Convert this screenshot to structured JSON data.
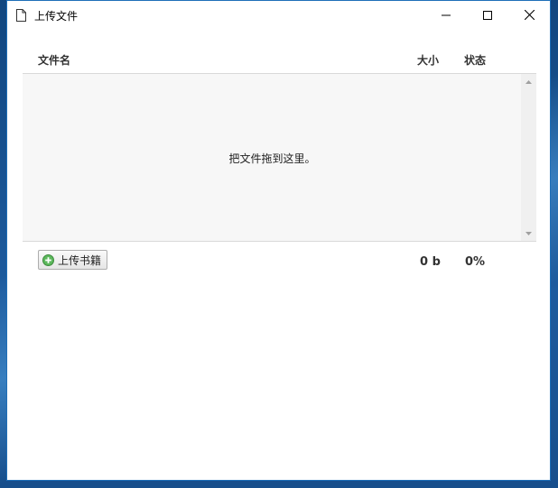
{
  "window": {
    "title": "上传文件",
    "frame_color": "#1f6fb8"
  },
  "table": {
    "columns": {
      "name": "文件名",
      "size": "大小",
      "status": "状态"
    },
    "drop_hint": "把文件拖到这里。"
  },
  "footer": {
    "upload_button": "上传书籍",
    "upload_icon": "plus-circle-icon",
    "total_size": "0 b",
    "total_progress": "0%"
  },
  "accent": "#4caf50"
}
